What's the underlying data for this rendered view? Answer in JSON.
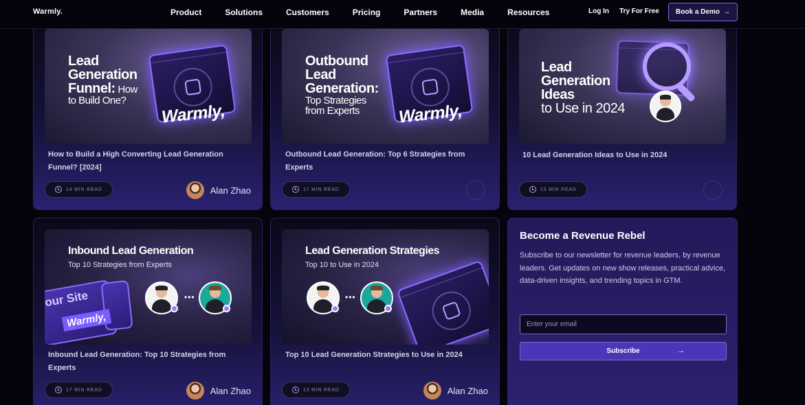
{
  "nav": {
    "logo": "Warmly.",
    "items": [
      "Product",
      "Solutions",
      "Customers",
      "Pricing",
      "Partners",
      "Media",
      "Resources"
    ],
    "login": "Log In",
    "try_free": "Try For Free",
    "demo": "Book a Demo",
    "demo_arrow": "→"
  },
  "cards": [
    {
      "thumb_line1": "Lead",
      "thumb_line2": "Generation",
      "thumb_line3": "Funnel:",
      "thumb_line3b": " How",
      "thumb_line4": "to Build One?",
      "brand": "Warmly,",
      "title": "How to Build a High Converting Lead Generation Funnel? [2024]",
      "read_time": "14 MIN READ",
      "author": "Alan Zhao"
    },
    {
      "thumb_line1": "Outbound",
      "thumb_line2": "Lead",
      "thumb_line3": "Generation:",
      "thumb_line4": "Top Strategies",
      "thumb_line5": "from Experts",
      "brand": "Warmly,",
      "title": "Outbound Lead Generation: Top 6 Strategies from Experts",
      "read_time": "17 MIN READ"
    },
    {
      "thumb_line1": "Lead",
      "thumb_line2": "Generation",
      "thumb_line3": "Ideas",
      "thumb_line4": "to Use in 2024",
      "title": "10 Lead Generation Ideas to Use in 2024",
      "read_time": "13 MIN READ"
    },
    {
      "thumb_title": "Inbound Lead Generation",
      "thumb_sub": "Top 10 Strategies from Experts",
      "site_text": "our Site",
      "ribbon": "Warmly,",
      "title": "Inbound Lead Generation: Top 10 Strategies from Experts",
      "read_time": "17 MIN READ",
      "author": "Alan Zhao"
    },
    {
      "thumb_title": "Lead Generation Strategies",
      "thumb_sub": "Top 10 to Use in 2024",
      "title": "Top 10 Lead Generation Strategies to Use in 2024",
      "read_time": "13 MIN READ",
      "author": "Alan Zhao"
    }
  ],
  "newsletter": {
    "title": "Become a Revenue Rebel",
    "description": "Subscribe to our newsletter for revenue leaders, by revenue leaders. Get updates on new show releases, practical advice, data-driven insights, and trending topics in GTM.",
    "placeholder": "Enter your email",
    "button": "Subscribe",
    "button_arrow": "→"
  },
  "colors": {
    "accent": "#7b5cff",
    "background": "#05040c",
    "card_border": "#2a2457"
  },
  "icons": [
    "arrow-right-icon",
    "clock-icon",
    "magnifier-icon",
    "chip-icon"
  ]
}
